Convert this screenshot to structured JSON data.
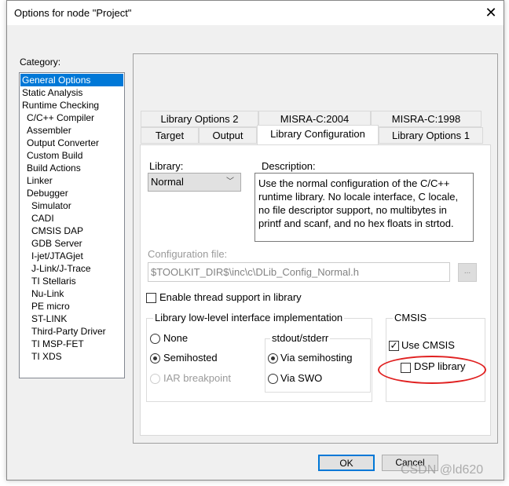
{
  "dialog": {
    "title": "Options for node \"Project\"",
    "close_icon": "close-icon"
  },
  "category": {
    "label": "Category:",
    "items": [
      {
        "label": "General Options",
        "level": 0,
        "selected": true
      },
      {
        "label": "Static Analysis",
        "level": 0
      },
      {
        "label": "Runtime Checking",
        "level": 0
      },
      {
        "label": "C/C++ Compiler",
        "level": 1
      },
      {
        "label": "Assembler",
        "level": 1
      },
      {
        "label": "Output Converter",
        "level": 1
      },
      {
        "label": "Custom Build",
        "level": 1
      },
      {
        "label": "Build Actions",
        "level": 1
      },
      {
        "label": "Linker",
        "level": 1
      },
      {
        "label": "Debugger",
        "level": 1
      },
      {
        "label": "Simulator",
        "level": 2
      },
      {
        "label": "CADI",
        "level": 2
      },
      {
        "label": "CMSIS DAP",
        "level": 2
      },
      {
        "label": "GDB Server",
        "level": 2
      },
      {
        "label": "I-jet/JTAGjet",
        "level": 2
      },
      {
        "label": "J-Link/J-Trace",
        "level": 2
      },
      {
        "label": "TI Stellaris",
        "level": 2
      },
      {
        "label": "Nu-Link",
        "level": 2
      },
      {
        "label": "PE micro",
        "level": 2
      },
      {
        "label": "ST-LINK",
        "level": 2
      },
      {
        "label": "Third-Party Driver",
        "level": 2
      },
      {
        "label": "TI MSP-FET",
        "level": 2
      },
      {
        "label": "TI XDS",
        "level": 2
      }
    ]
  },
  "tabs": {
    "row1": [
      "Library Options 2",
      "MISRA-C:2004",
      "MISRA-C:1998"
    ],
    "row2": [
      "Target",
      "Output",
      "Library Configuration",
      "Library Options 1"
    ],
    "active": "Library Configuration"
  },
  "library": {
    "label": "Library:",
    "value": "Normal"
  },
  "description": {
    "label": "Description:",
    "text": "Use the normal configuration of the C/C++ runtime library. No locale interface, C locale, no file descriptor support, no multibytes in printf and scanf, and no hex floats in strtod."
  },
  "config_file": {
    "label": "Configuration file:",
    "value": "$TOOLKIT_DIR$\\inc\\c\\DLib_Config_Normal.h",
    "browse": "..."
  },
  "thread_support": {
    "label": "Enable thread support in library",
    "checked": false
  },
  "lowlevel": {
    "title": "Library low-level interface implementation",
    "options": [
      {
        "label": "None",
        "selected": false
      },
      {
        "label": "Semihosted",
        "selected": true
      },
      {
        "label": "IAR breakpoint",
        "selected": false,
        "disabled": true
      }
    ]
  },
  "stdout": {
    "title": "stdout/stderr",
    "options": [
      {
        "label": "Via semihosting",
        "selected": true
      },
      {
        "label": "Via SWO",
        "selected": false
      }
    ]
  },
  "cmsis": {
    "title": "CMSIS",
    "use_cmsis": {
      "label": "Use CMSIS",
      "checked": true
    },
    "dsp": {
      "label": "DSP library",
      "checked": false
    },
    "highlight_color": "#e02020"
  },
  "buttons": {
    "ok": "OK",
    "cancel": "Cancel"
  },
  "watermark": "CSDN @ld620"
}
